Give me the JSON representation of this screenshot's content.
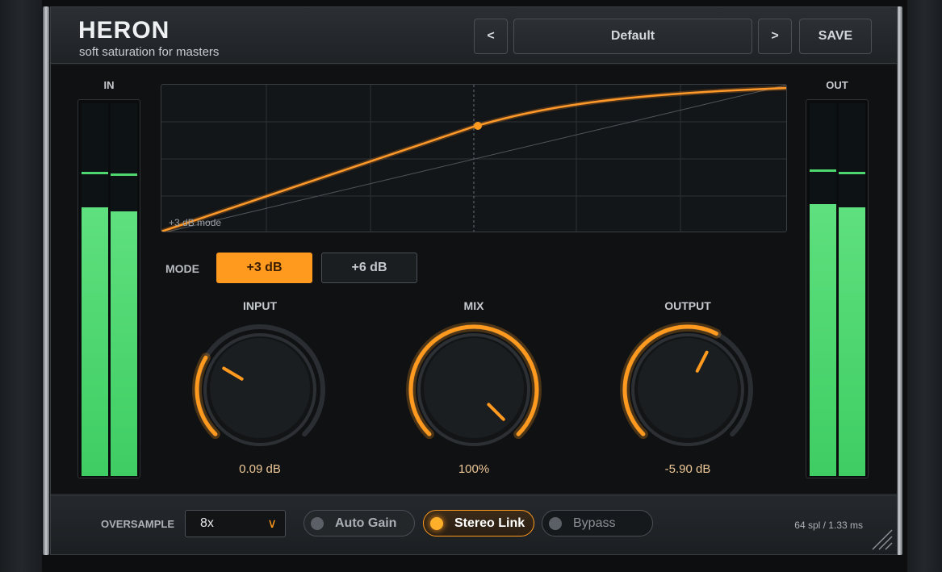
{
  "header": {
    "title": "HERON",
    "subtitle": "soft saturation for masters",
    "prev_label": "<",
    "preset_name": "Default",
    "next_label": ">",
    "save_label": "SAVE"
  },
  "meters": {
    "in_label": "IN",
    "out_label": "OUT",
    "in_levels": [
      0.72,
      0.71
    ],
    "in_peaks": [
      0.81,
      0.805
    ],
    "out_levels": [
      0.73,
      0.72
    ],
    "out_peaks": [
      0.815,
      0.81
    ]
  },
  "graph": {
    "note": "+3 dB mode"
  },
  "mode": {
    "label": "MODE",
    "options": [
      "+3 dB",
      "+6 dB"
    ],
    "selected": "+3 dB"
  },
  "knobs": [
    {
      "label": "INPUT",
      "value": "0.09 dB",
      "fraction": 0.28
    },
    {
      "label": "MIX",
      "value": "100%",
      "fraction": 1.0
    },
    {
      "label": "OUTPUT",
      "value": "-5.90 dB",
      "fraction": 0.6
    }
  ],
  "footer": {
    "oversample_label": "OVERSAMPLE",
    "oversample_value": "8x",
    "auto_gain": "Auto Gain",
    "auto_gain_on": false,
    "stereo_link": "Stereo Link",
    "stereo_link_on": true,
    "bypass": "Bypass",
    "bypass_on": false,
    "latency": "64 spl / 1.33 ms"
  },
  "colors": {
    "accent": "#ff9a1f",
    "meter_green": "#4ed66f"
  }
}
